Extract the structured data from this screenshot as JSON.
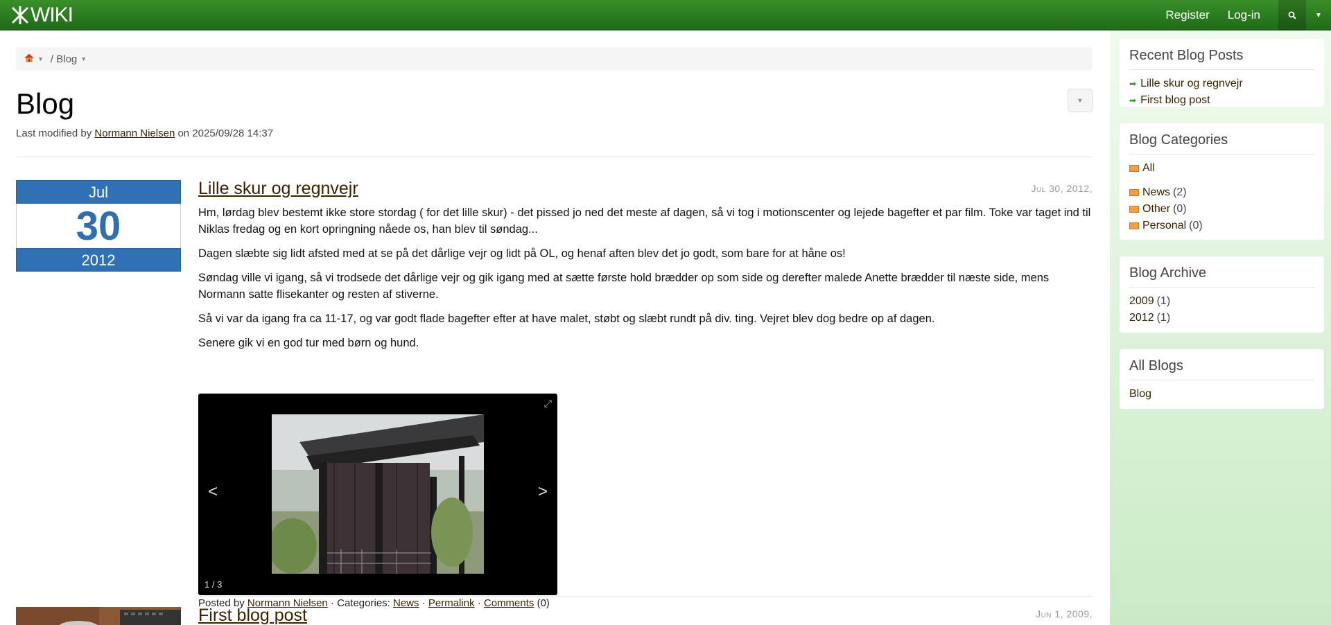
{
  "topbar": {
    "logo_text": "WIKI",
    "register": "Register",
    "login": "Log-in",
    "search_icon": "search-icon",
    "bg_color": "#2a7a1f"
  },
  "breadcrumb": {
    "home_icon": "home-icon",
    "current": "/ Blog"
  },
  "page": {
    "title": "Blog",
    "meta_prefix": "Last modified by",
    "meta_author": "Normann Nielsen",
    "meta_suffix": "on 2025/09/28 14:37"
  },
  "posts": [
    {
      "date_month": "Jul",
      "date_day": "30",
      "date_year": "2012",
      "title": "Lille skur og regnvejr",
      "date_label": "Jul 30, 2012,",
      "paragraphs": [
        "Hm, lørdag blev bestemt ikke store stordag ( for det lille skur) - det pissed jo ned det meste af dagen, så vi tog i motionscenter og lejede bagefter et par film. Toke var taget ind til Niklas fredag og en kort opringning nåede os, han blev til søndag...",
        "Dagen slæbte sig lidt afsted med at se på det dårlige vejr og lidt på OL, og henaf aften blev det jo godt, som bare for at håne os!",
        "Søndag ville vi igang, så vi trodsede det dårlige vejr og gik igang med at sætte første hold brædder op som side og derefter malede Anette brædder til næste side, mens Normann satte flisekanter og resten af stiverne.",
        "Så vi var da igang fra ca 11-17, og var godt flade bagefter efter at have malet, støbt og slæbt rundt på div. ting. Vejret blev dog bedre op af dagen.",
        "Senere gik vi en god tur med børn og hund."
      ],
      "gallery": {
        "prev": "<",
        "next": ">",
        "counter": "1 / 3"
      },
      "footer": {
        "posted_by": "Posted by",
        "author": "Normann Nielsen",
        "categories_label": "· Categories:",
        "category": "News",
        "sep1": "·",
        "permalink": "Permalink",
        "sep2": "·",
        "comments": "Comments",
        "comments_count": "(0)"
      }
    },
    {
      "title": "First blog post",
      "date_label": "Jun 1, 2009,"
    }
  ],
  "sidebar": {
    "recent": {
      "title": "Recent Blog Posts",
      "items": [
        "Lille skur og regnvejr",
        "First blog post"
      ]
    },
    "categories": {
      "title": "Blog Categories",
      "all": "All",
      "items": [
        {
          "label": "News",
          "count": "(2)"
        },
        {
          "label": "Other",
          "count": "(0)"
        },
        {
          "label": "Personal",
          "count": "(0)"
        }
      ]
    },
    "archive": {
      "title": "Blog Archive",
      "items": [
        {
          "label": "2009",
          "count": "(1)"
        },
        {
          "label": "2012",
          "count": "(1)"
        }
      ]
    },
    "all_blogs": {
      "title": "All Blogs",
      "items": [
        "Blog"
      ]
    }
  }
}
